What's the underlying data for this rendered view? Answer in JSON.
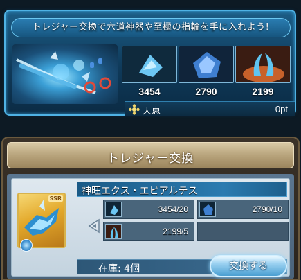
{
  "banner": {
    "title": "トレジャー交換で六道神器や至極の指輪を手に入れよう!",
    "materials": [
      {
        "icon": "blue-crystal-icon",
        "count": "3454"
      },
      {
        "icon": "dark-blue-gem-icon",
        "count": "2790"
      },
      {
        "icon": "blue-horns-icon",
        "count": "2199"
      }
    ],
    "currency": {
      "icon": "tenkei-flower-icon",
      "label": "天恵",
      "value": "0pt"
    }
  },
  "exchange": {
    "title": "トレジャー交換",
    "item": {
      "name": "神旺エクス・エピアルテス",
      "rarity": "SSR",
      "stock": "在庫: 4個"
    },
    "requirements": [
      {
        "icon": "blue-crystal-icon",
        "text": "3454/20"
      },
      {
        "icon": "dark-blue-gem-icon",
        "text": "2790/10"
      },
      {
        "icon": "blue-horns-icon",
        "text": "2199/5"
      }
    ],
    "button_label": "交換する"
  },
  "colors": {
    "banner_border": "#4fb2e4",
    "panel_gold": "#b8a47c",
    "button_blue": "#4a9fd2"
  }
}
